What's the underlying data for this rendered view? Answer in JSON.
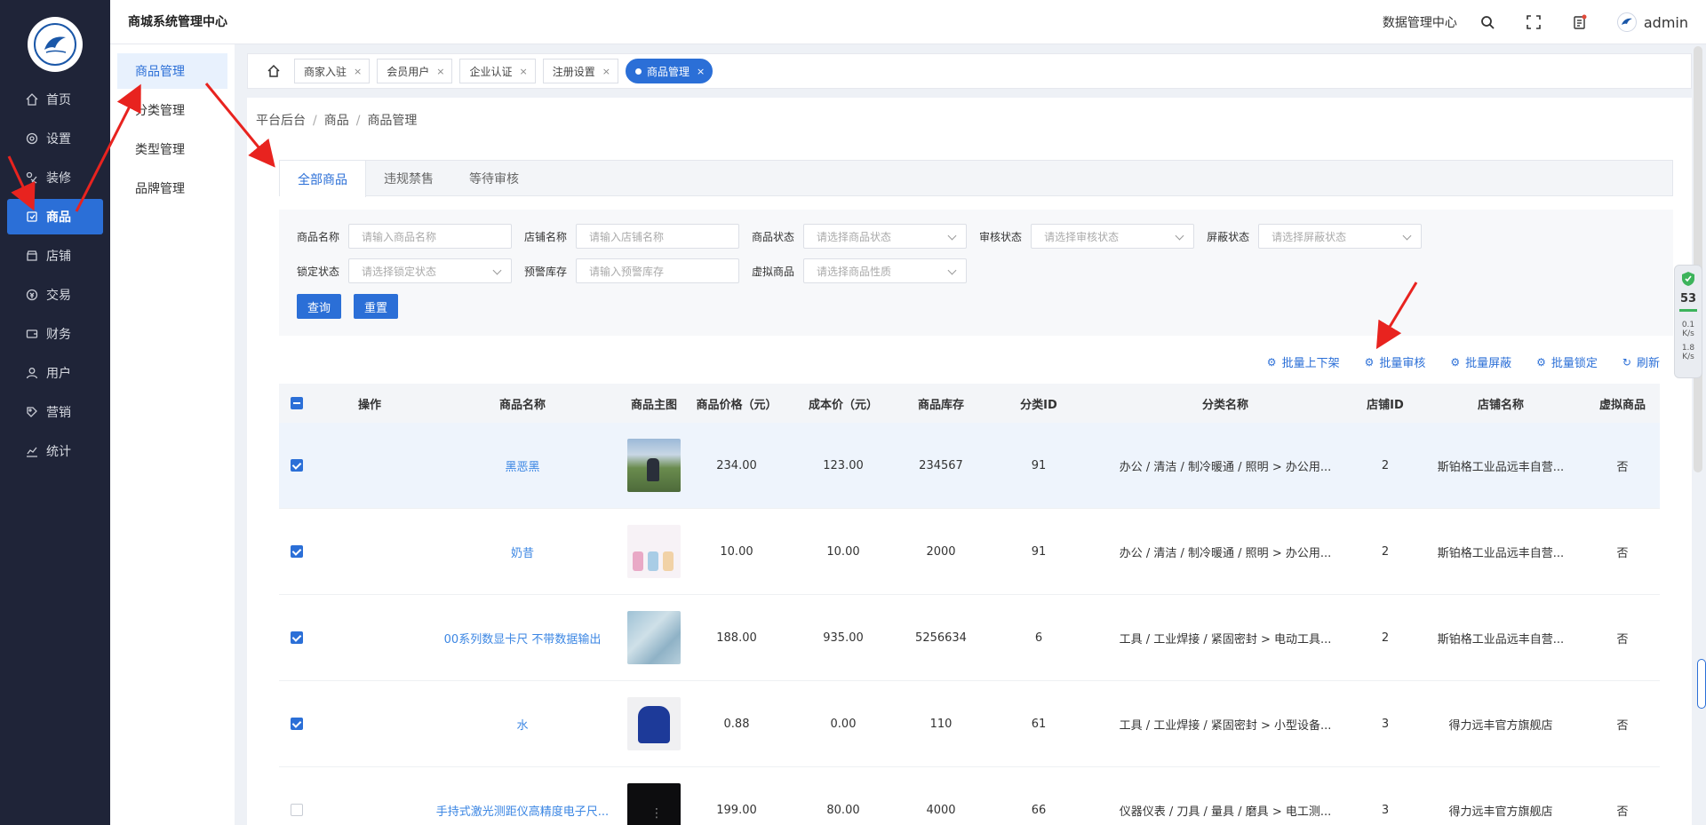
{
  "sidebar": {
    "items": [
      {
        "label": "首页",
        "icon": "home-icon"
      },
      {
        "label": "设置",
        "icon": "gear-icon"
      },
      {
        "label": "装修",
        "icon": "decorate-icon"
      },
      {
        "label": "商品",
        "icon": "goods-icon"
      },
      {
        "label": "店铺",
        "icon": "shop-icon"
      },
      {
        "label": "交易",
        "icon": "trade-icon"
      },
      {
        "label": "财务",
        "icon": "finance-icon"
      },
      {
        "label": "用户",
        "icon": "user-icon"
      },
      {
        "label": "营销",
        "icon": "marketing-icon"
      },
      {
        "label": "统计",
        "icon": "stats-icon"
      }
    ],
    "active_index": 3
  },
  "submenu": {
    "items": [
      "商品管理",
      "分类管理",
      "类型管理",
      "品牌管理"
    ],
    "active_index": 0
  },
  "header": {
    "title": "商城系统管理中心",
    "data_center": "数据管理中心",
    "username": "admin"
  },
  "tabs": [
    {
      "label": "商家入驻"
    },
    {
      "label": "会员用户"
    },
    {
      "label": "企业认证"
    },
    {
      "label": "注册设置"
    },
    {
      "label": "商品管理",
      "active": true
    }
  ],
  "breadcrumb": [
    "平台后台",
    "商品",
    "商品管理"
  ],
  "subtabs": [
    "全部商品",
    "违规禁售",
    "等待审核"
  ],
  "filters": {
    "row1": [
      {
        "label": "商品名称",
        "placeholder": "请输入商品名称",
        "type": "input"
      },
      {
        "label": "店铺名称",
        "placeholder": "请输入店铺名称",
        "type": "input"
      },
      {
        "label": "商品状态",
        "placeholder": "请选择商品状态",
        "type": "select"
      },
      {
        "label": "审核状态",
        "placeholder": "请选择审核状态",
        "type": "select"
      },
      {
        "label": "屏蔽状态",
        "placeholder": "请选择屏蔽状态",
        "type": "select"
      }
    ],
    "row2": [
      {
        "label": "锁定状态",
        "placeholder": "请选择锁定状态",
        "type": "select"
      },
      {
        "label": "预警库存",
        "placeholder": "请输入预警库存",
        "type": "input"
      },
      {
        "label": "虚拟商品",
        "placeholder": "请选择商品性质",
        "type": "select"
      }
    ],
    "query_label": "查询",
    "reset_label": "重置"
  },
  "actions": [
    "批量上下架",
    "批量审核",
    "批量屏蔽",
    "批量锁定",
    "刷新"
  ],
  "table": {
    "headers": [
      "操作",
      "商品名称",
      "商品主图",
      "商品价格（元）",
      "成本价（元）",
      "商品库存",
      "分类ID",
      "分类名称",
      "店铺ID",
      "店铺名称",
      "虚拟商品"
    ],
    "rows": [
      {
        "checked": true,
        "highlight": true,
        "name": "黑恶黑",
        "price": "234.00",
        "cost": "123.00",
        "stock": "234567",
        "cat_id": "91",
        "cat_name": "办公 / 清洁 / 制冷暖通 / 照明 > 办公用...",
        "shop_id": "2",
        "shop_name": "斯铂格工业品远丰自营...",
        "virtual": "否"
      },
      {
        "checked": true,
        "highlight": false,
        "name": "奶昔",
        "price": "10.00",
        "cost": "10.00",
        "stock": "2000",
        "cat_id": "91",
        "cat_name": "办公 / 清洁 / 制冷暖通 / 照明 > 办公用...",
        "shop_id": "2",
        "shop_name": "斯铂格工业品远丰自营...",
        "virtual": "否"
      },
      {
        "checked": true,
        "highlight": false,
        "name": "00系列数显卡尺 不带数据输出",
        "price": "188.00",
        "cost": "935.00",
        "stock": "5256634",
        "cat_id": "6",
        "cat_name": "工具 / 工业焊接 / 紧固密封 > 电动工具...",
        "shop_id": "2",
        "shop_name": "斯铂格工业品远丰自营...",
        "virtual": "否"
      },
      {
        "checked": true,
        "highlight": false,
        "name": "水",
        "price": "0.88",
        "cost": "0.00",
        "stock": "110",
        "cat_id": "61",
        "cat_name": "工具 / 工业焊接 / 紧固密封 > 小型设备...",
        "shop_id": "3",
        "shop_name": "得力远丰官方旗舰店",
        "virtual": "否"
      },
      {
        "checked": false,
        "highlight": false,
        "name": "手持式激光测距仪高精度电子尺...",
        "price": "199.00",
        "cost": "80.00",
        "stock": "4000",
        "cat_id": "66",
        "cat_name": "仪器仪表 / 刀具 / 量具 / 磨具 > 电工测...",
        "shop_id": "3",
        "shop_name": "得力远丰官方旗舰店",
        "virtual": "否"
      }
    ]
  },
  "widget": {
    "percent": "53",
    "up": "0.1",
    "down": "1.8",
    "unit": "K/s"
  }
}
